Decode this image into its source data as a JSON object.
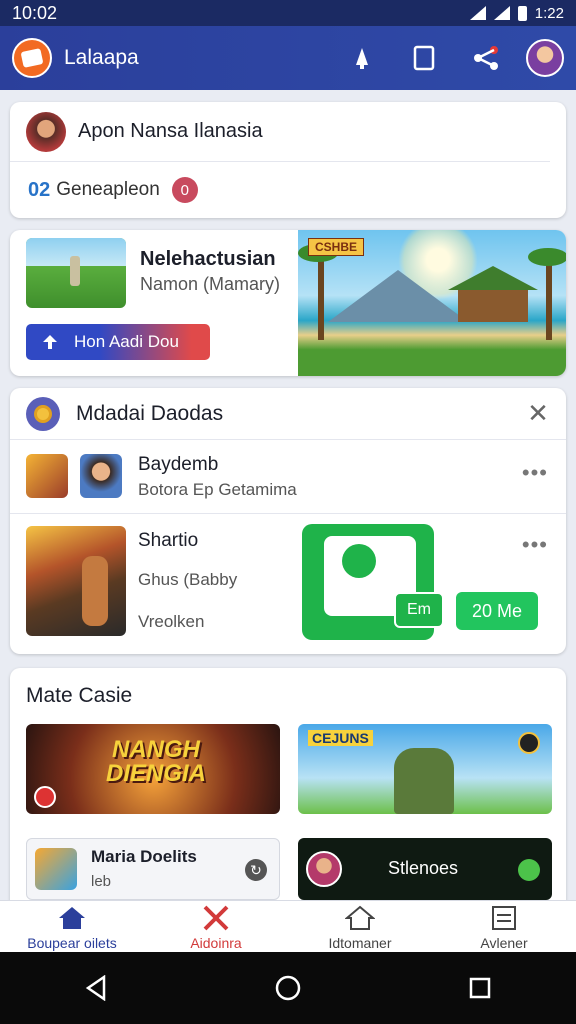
{
  "status_bar": {
    "time": "10:02",
    "right_text": "1:22"
  },
  "app_bar": {
    "title": "Lalaapa"
  },
  "profile_card": {
    "name": "Apon Nansa Ilanasia",
    "number": "02",
    "label": "Geneapleon",
    "count": "0"
  },
  "promo_card": {
    "title": "Nelehactusian",
    "subtitle": "Namon (Mamary)",
    "button_label": "Hon Aadi Dou",
    "banner_tag": "CSHBE"
  },
  "games_card": {
    "title": "Mdadai Daodas",
    "row1": {
      "title": "Baydemb",
      "subtitle": "Botora Ep Getamima"
    },
    "row2": {
      "title": "Shartio",
      "line2": "Ghus (Babby",
      "line3": "Vreolken",
      "tag_label": "Em",
      "size_label": "20 Me"
    }
  },
  "more_card": {
    "title": "Mate Casie",
    "game1_logo": "NANGH DIENGIA",
    "game2_label": "CEJUNS",
    "item3": {
      "title": "Maria Doelits",
      "sub": "leb"
    },
    "item4": {
      "title": "Stlenoes"
    }
  },
  "bottom_nav": [
    {
      "label": "Boupear oilets"
    },
    {
      "label": "Aidoinra"
    },
    {
      "label": "Idtomaner"
    },
    {
      "label": "Avlener"
    }
  ],
  "colors": {
    "primary": "#2b3f9b",
    "accent_orange": "#f26a22",
    "green": "#1fb34a",
    "red": "#d23a3a"
  }
}
